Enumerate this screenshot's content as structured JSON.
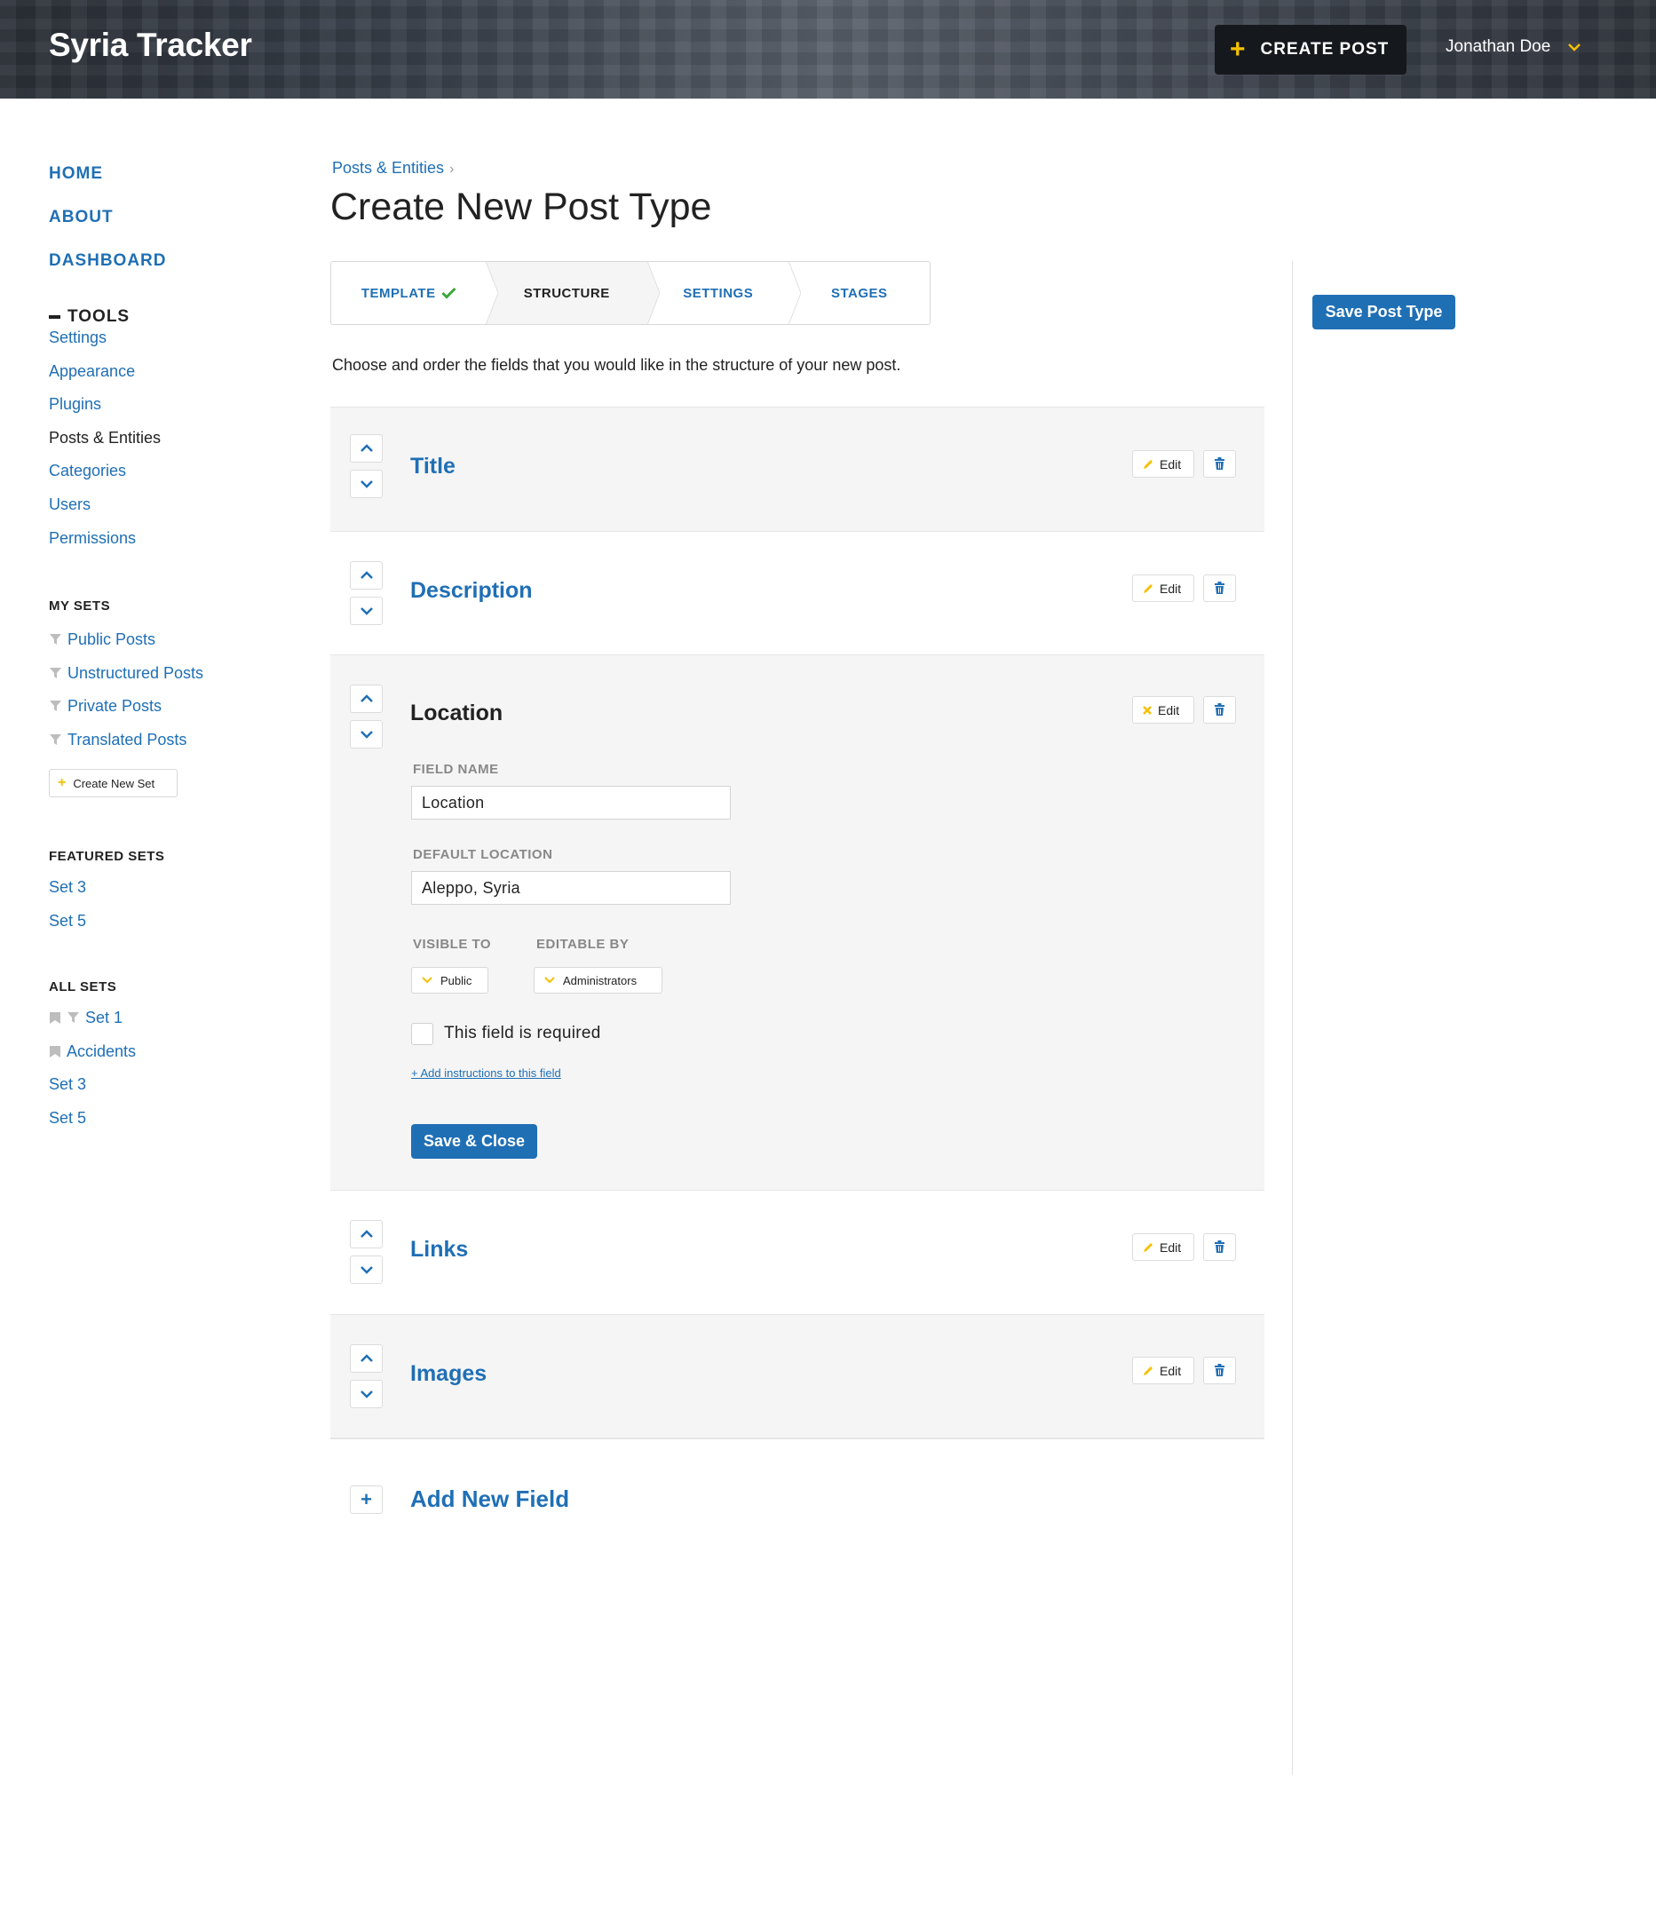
{
  "header": {
    "brand": "Syria Tracker",
    "create_post": "CREATE POST",
    "user_name": "Jonathan Doe"
  },
  "nav": {
    "main": [
      "HOME",
      "ABOUT",
      "DASHBOARD"
    ],
    "tools_label": "TOOLS",
    "tools": [
      "Settings",
      "Appearance",
      "Plugins",
      "Posts & Entities",
      "Categories",
      "Users",
      "Permissions"
    ],
    "current_tool": "Posts & Entities"
  },
  "my_sets": {
    "heading": "MY SETS",
    "items": [
      "Public Posts",
      "Unstructured Posts",
      "Private Posts",
      "Translated Posts"
    ],
    "create_button": "Create New Set"
  },
  "featured_sets": {
    "heading": "FEATURED SETS",
    "items": [
      "Set 3",
      "Set 5"
    ]
  },
  "all_sets": {
    "heading": "ALL SETS",
    "items": [
      "Set 1",
      "Accidents",
      "Set 3",
      "Set 5"
    ]
  },
  "main": {
    "breadcrumb": "Posts & Entities",
    "title": "Create New Post Type",
    "steps": [
      "TEMPLATE",
      "STRUCTURE",
      "SETTINGS",
      "STAGES"
    ],
    "active_step": "STRUCTURE",
    "completed_step": "TEMPLATE",
    "instructions": "Choose and order the fields that you would like in the structure of your new post.",
    "save_post_type": "Save Post Type",
    "edit_label": "Edit",
    "fields": [
      "Title",
      "Description",
      "Location",
      "Links",
      "Images"
    ],
    "add_new_field": "Add New Field"
  },
  "location_form": {
    "field_name_label": "FIELD NAME",
    "field_name_value": "Location",
    "default_location_label": "DEFAULT LOCATION",
    "default_location_value": "Aleppo, Syria",
    "visible_to_label": "VISIBLE TO",
    "visible_to_value": "Public",
    "editable_by_label": "EDITABLE BY",
    "editable_by_value": "Administrators",
    "required_label": "This field is required",
    "required_checked": false,
    "add_instructions": "+ Add instructions to this field",
    "save_close": "Save & Close"
  },
  "colors": {
    "accent_blue": "#1f6fb5",
    "accent_yellow": "#f5c000",
    "success_green": "#3aa83a",
    "header_dark": "#2b3038"
  }
}
